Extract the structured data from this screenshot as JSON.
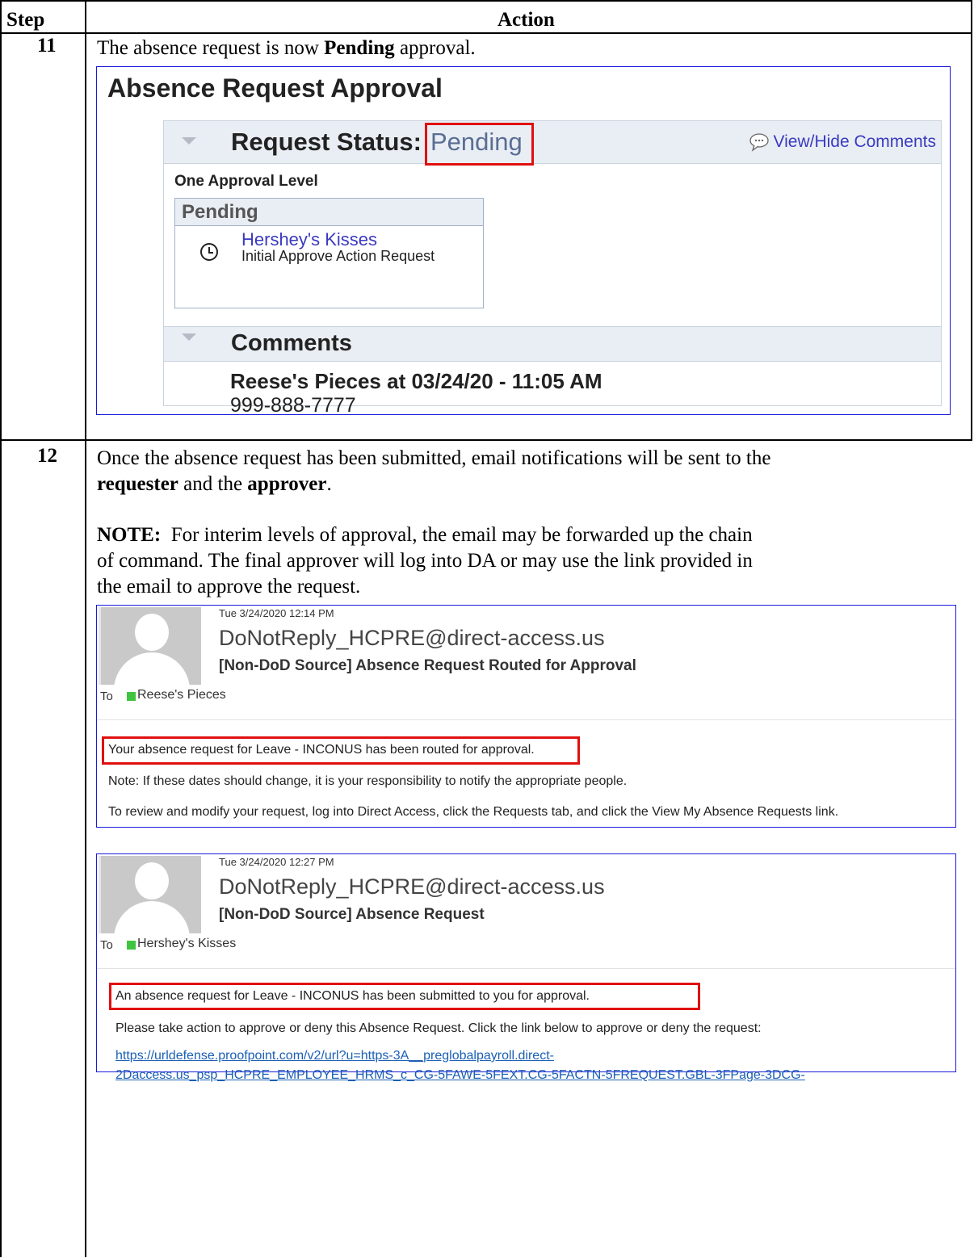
{
  "header": {
    "step": "Step",
    "action": "Action"
  },
  "step11": {
    "number": "11",
    "text_before": "The absence request is now ",
    "text_bold": "Pending",
    "text_after": " approval.",
    "screenshot": {
      "title": "Absence Request Approval",
      "status_label": "Request Status:",
      "status_value": "Pending",
      "view_hide_comments": "View/Hide Comments",
      "approval_level": "One Approval Level",
      "pending_header": "Pending",
      "approver_name": "Hershey's Kisses",
      "approver_action": "Initial Approve Action Request",
      "comments_header": "Comments",
      "comment_author": "Reese's Pieces at 03/24/20 - 11:05 AM",
      "comment_text": "999-888-7777"
    }
  },
  "step12": {
    "number": "12",
    "p1_a": "Once the absence request has been submitted, email notifications will be sent to the",
    "p1_bold1": "requester",
    "p1_mid": " and the ",
    "p1_bold2": "approver",
    "p1_end": ".",
    "note_label": "NOTE:",
    "note_l1": "  For interim levels of approval, the email may be forwarded up the chain",
    "note_l2": "of command.  The final approver will log into DA or may use the link provided in",
    "note_l3": "the email to approve the request.",
    "email1": {
      "date": "Tue 3/24/2020 12:14 PM",
      "from": "DoNotReply_HCPRE@direct-access.us",
      "subject": "[Non-DoD Source] Absence Request Routed for Approval",
      "to_label": "To",
      "to_name": "Reese's Pieces",
      "line1": "Your absence request for Leave - INCONUS has been routed for approval.",
      "line2": "Note: If these dates should change, it is your responsibility to notify the appropriate people.",
      "line3": "To review and modify your request, log into Direct Access, click the Requests tab, and click the View My Absence Requests link."
    },
    "email2": {
      "date": "Tue 3/24/2020 12:27 PM",
      "from": "DoNotReply_HCPRE@direct-access.us",
      "subject": "[Non-DoD Source] Absence Request",
      "to_label": "To",
      "to_name": "Hershey's Kisses",
      "line1": "An absence request for Leave - INCONUS has been submitted to you for approval.",
      "line2": "Please take action to approve or deny this Absence Request.  Click the link below to approve or deny the request:",
      "link1": "https://urldefense.proofpoint.com/v2/url?u=https-3A__preglobalpayroll.direct-",
      "link2": "2Daccess.us_psp_HCPRE_EMPLOYEE_HRMS_c_CG-5FAWE-5FEXT.CG-5FACTN-5FREQUEST.GBL-3FPage-3DCG-"
    }
  },
  "colors": {
    "highlight": "#e01010",
    "link": "#1a5fb4",
    "screenshot_border": "#1a1adc"
  }
}
